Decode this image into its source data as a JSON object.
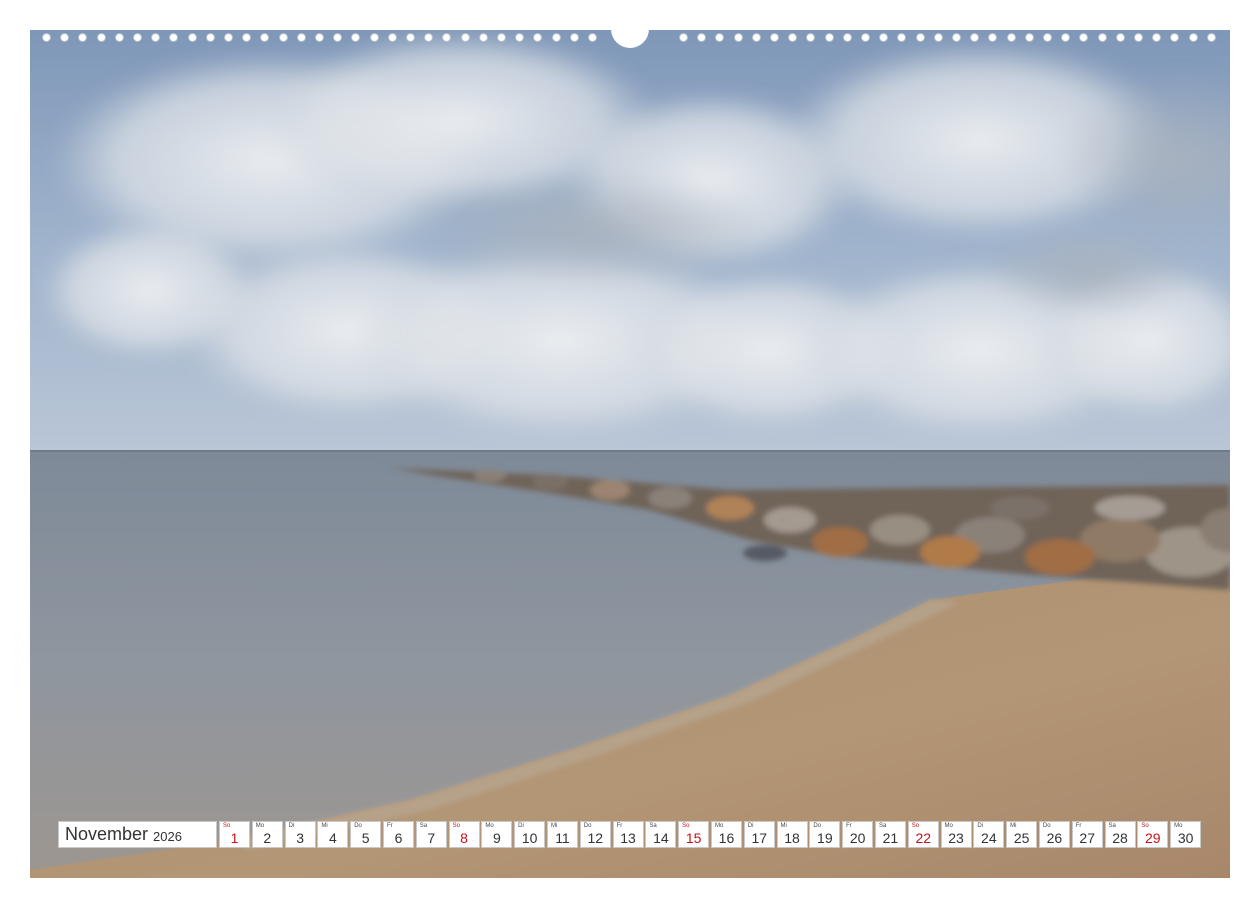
{
  "calendar": {
    "month": "November",
    "year": "2026",
    "sunday_color": "#c4111b",
    "days": [
      {
        "weekday": "So",
        "day": "1",
        "sunday": true
      },
      {
        "weekday": "Mo",
        "day": "2",
        "sunday": false
      },
      {
        "weekday": "Di",
        "day": "3",
        "sunday": false
      },
      {
        "weekday": "Mi",
        "day": "4",
        "sunday": false
      },
      {
        "weekday": "Do",
        "day": "5",
        "sunday": false
      },
      {
        "weekday": "Fr",
        "day": "6",
        "sunday": false
      },
      {
        "weekday": "Sa",
        "day": "7",
        "sunday": false
      },
      {
        "weekday": "So",
        "day": "8",
        "sunday": true
      },
      {
        "weekday": "Mo",
        "day": "9",
        "sunday": false
      },
      {
        "weekday": "Di",
        "day": "10",
        "sunday": false
      },
      {
        "weekday": "Mi",
        "day": "11",
        "sunday": false
      },
      {
        "weekday": "Do",
        "day": "12",
        "sunday": false
      },
      {
        "weekday": "Fr",
        "day": "13",
        "sunday": false
      },
      {
        "weekday": "Sa",
        "day": "14",
        "sunday": false
      },
      {
        "weekday": "So",
        "day": "15",
        "sunday": true
      },
      {
        "weekday": "Mo",
        "day": "16",
        "sunday": false
      },
      {
        "weekday": "Di",
        "day": "17",
        "sunday": false
      },
      {
        "weekday": "Mi",
        "day": "18",
        "sunday": false
      },
      {
        "weekday": "Do",
        "day": "19",
        "sunday": false
      },
      {
        "weekday": "Fr",
        "day": "20",
        "sunday": false
      },
      {
        "weekday": "Sa",
        "day": "21",
        "sunday": false
      },
      {
        "weekday": "So",
        "day": "22",
        "sunday": true
      },
      {
        "weekday": "Mo",
        "day": "23",
        "sunday": false
      },
      {
        "weekday": "Di",
        "day": "24",
        "sunday": false
      },
      {
        "weekday": "Mi",
        "day": "25",
        "sunday": false
      },
      {
        "weekday": "Do",
        "day": "26",
        "sunday": false
      },
      {
        "weekday": "Fr",
        "day": "27",
        "sunday": false
      },
      {
        "weekday": "Sa",
        "day": "28",
        "sunday": false
      },
      {
        "weekday": "So",
        "day": "29",
        "sunday": true
      },
      {
        "weekday": "Mo",
        "day": "30",
        "sunday": false
      }
    ]
  }
}
